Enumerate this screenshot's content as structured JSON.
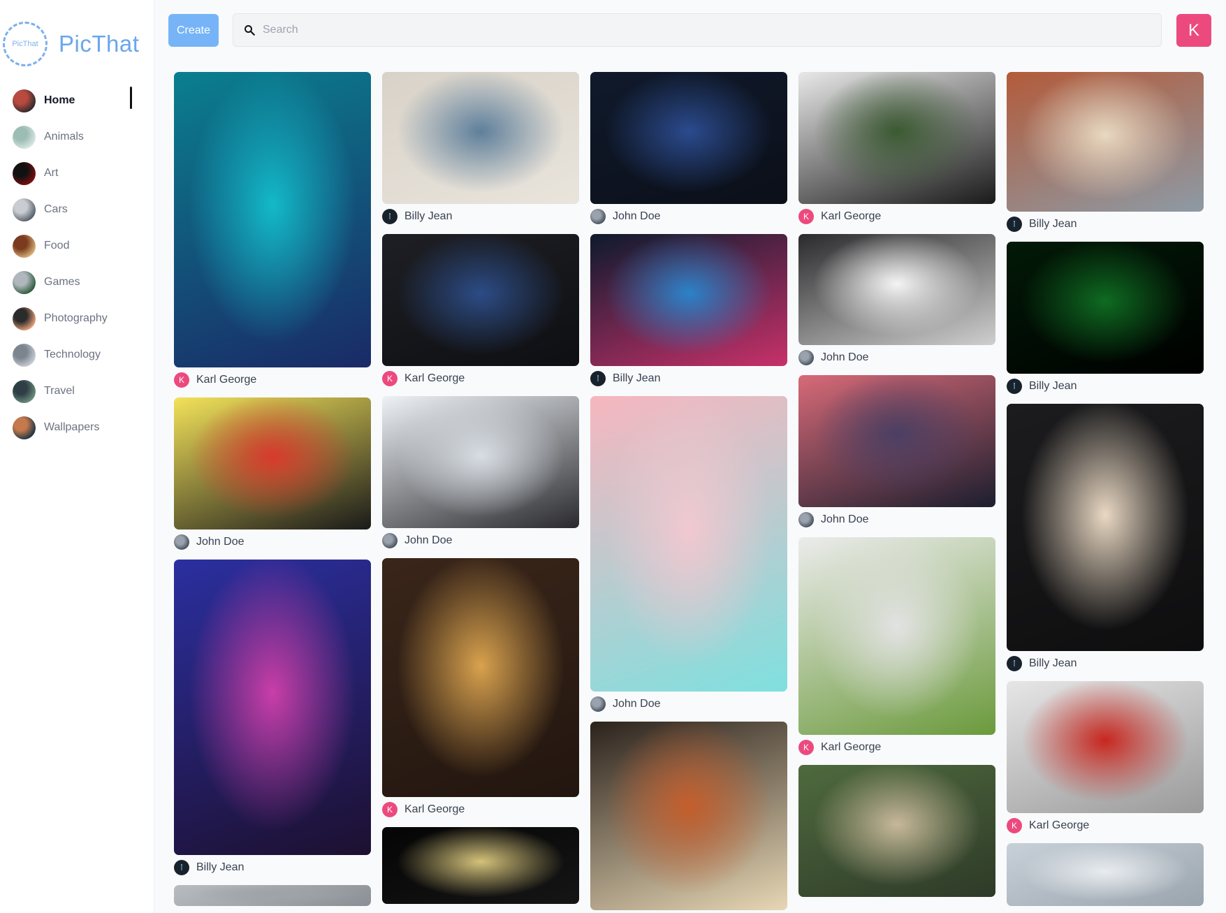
{
  "app": {
    "logo_mark": "PicThat",
    "name": "PicThat"
  },
  "nav": {
    "items": [
      {
        "label": "Home",
        "active": true,
        "colors": [
          "#2b2b2b",
          "#b94a40"
        ]
      },
      {
        "label": "Animals",
        "active": false,
        "colors": [
          "#d9e7e3",
          "#9dbdb4"
        ]
      },
      {
        "label": "Art",
        "active": false,
        "colors": [
          "#7a1010",
          "#111111"
        ]
      },
      {
        "label": "Cars",
        "active": false,
        "colors": [
          "#555e68",
          "#c9cdd2"
        ]
      },
      {
        "label": "Food",
        "active": false,
        "colors": [
          "#d7b37a",
          "#7a3b1e"
        ]
      },
      {
        "label": "Games",
        "active": false,
        "colors": [
          "#2f5a3c",
          "#b0b7bd"
        ]
      },
      {
        "label": "Photography",
        "active": false,
        "colors": [
          "#e6a07a",
          "#2b2b2b"
        ]
      },
      {
        "label": "Technology",
        "active": false,
        "colors": [
          "#c9ced4",
          "#7c858f"
        ]
      },
      {
        "label": "Travel",
        "active": false,
        "colors": [
          "#6b8f7c",
          "#2f3e46"
        ]
      },
      {
        "label": "Wallpapers",
        "active": false,
        "colors": [
          "#1b3347",
          "#c47a4c"
        ]
      }
    ]
  },
  "header": {
    "create_label": "Create",
    "search_placeholder": "Search",
    "user_initial": "K"
  },
  "users": {
    "karl": {
      "name": "Karl George",
      "initial": "K",
      "color": "#ec4a7e"
    },
    "john": {
      "name": "John Doe"
    },
    "billy": {
      "name": "Billy Jean"
    }
  },
  "feed": [
    [
      {
        "user": "karl",
        "h": 423,
        "colors": [
          "#0a7f8f",
          "#13b9c9",
          "#1a2a66"
        ]
      },
      {
        "user": "john",
        "h": 189,
        "colors": [
          "#f3e25a",
          "#d83a2c",
          "#1a1a1a"
        ]
      },
      {
        "user": "billy",
        "h": 423,
        "colors": [
          "#2b2fa0",
          "#c93ea8",
          "#1d1030"
        ]
      },
      {
        "user": "none",
        "h": 30,
        "colors": [
          "#b9bcc0",
          "#9ea3a8",
          "#8a8f95"
        ]
      }
    ],
    [
      {
        "user": "billy",
        "h": 189,
        "colors": [
          "#d8d2c8",
          "#5e7f9b",
          "#e9e4dc"
        ]
      },
      {
        "user": "karl",
        "h": 189,
        "colors": [
          "#1e1f24",
          "#2c4c86",
          "#0e0f12"
        ]
      },
      {
        "user": "john",
        "h": 189,
        "colors": [
          "#eef2f6",
          "#d7dde3",
          "#2a2a2e"
        ]
      },
      {
        "user": "karl",
        "h": 342,
        "colors": [
          "#3a261a",
          "#d9a24e",
          "#22160f"
        ]
      },
      {
        "user": "none",
        "h": 110,
        "colors": [
          "#050505",
          "#d4c27a",
          "#151515"
        ]
      }
    ],
    [
      {
        "user": "john",
        "h": 189,
        "colors": [
          "#101a2c",
          "#2b4b8e",
          "#0b0f18"
        ]
      },
      {
        "user": "billy",
        "h": 189,
        "colors": [
          "#0d1a2e",
          "#2b82c9",
          "#c7316a"
        ]
      },
      {
        "user": "john",
        "h": 423,
        "colors": [
          "#f7b6bf",
          "#f1c8d0",
          "#7fe0df"
        ]
      },
      {
        "user": "none",
        "h": 270,
        "colors": [
          "#2b221c",
          "#c45e2c",
          "#e7d7b5"
        ]
      }
    ],
    [
      {
        "user": "karl",
        "h": 189,
        "colors": [
          "#e8e8e8",
          "#3b5a32",
          "#1a1a1a"
        ]
      },
      {
        "user": "john",
        "h": 159,
        "colors": [
          "#2a2a2c",
          "#f4f4f4",
          "#cfcfcf"
        ]
      },
      {
        "user": "john",
        "h": 189,
        "colors": [
          "#d86a78",
          "#4b3f63",
          "#1c1e2e"
        ]
      },
      {
        "user": "karl",
        "h": 283,
        "colors": [
          "#ececec",
          "#e2e2e2",
          "#6b9a3c"
        ]
      },
      {
        "user": "none",
        "h": 189,
        "colors": [
          "#4f6a3e",
          "#c7b89a",
          "#2e3a28"
        ]
      }
    ],
    [
      {
        "user": "billy",
        "h": 200,
        "colors": [
          "#b35b3a",
          "#e9d8c0",
          "#8d9aa5"
        ]
      },
      {
        "user": "billy",
        "h": 189,
        "colors": [
          "#021a07",
          "#0f6b22",
          "#000000"
        ]
      },
      {
        "user": "billy",
        "h": 354,
        "colors": [
          "#1c1c1e",
          "#e9d8c3",
          "#0e0e0f"
        ]
      },
      {
        "user": "karl",
        "h": 189,
        "colors": [
          "#e6e6e6",
          "#c7271f",
          "#9a9a9a"
        ]
      },
      {
        "user": "none",
        "h": 90,
        "colors": [
          "#c8d0d8",
          "#e8ecef",
          "#9aa4ad"
        ]
      }
    ]
  ]
}
